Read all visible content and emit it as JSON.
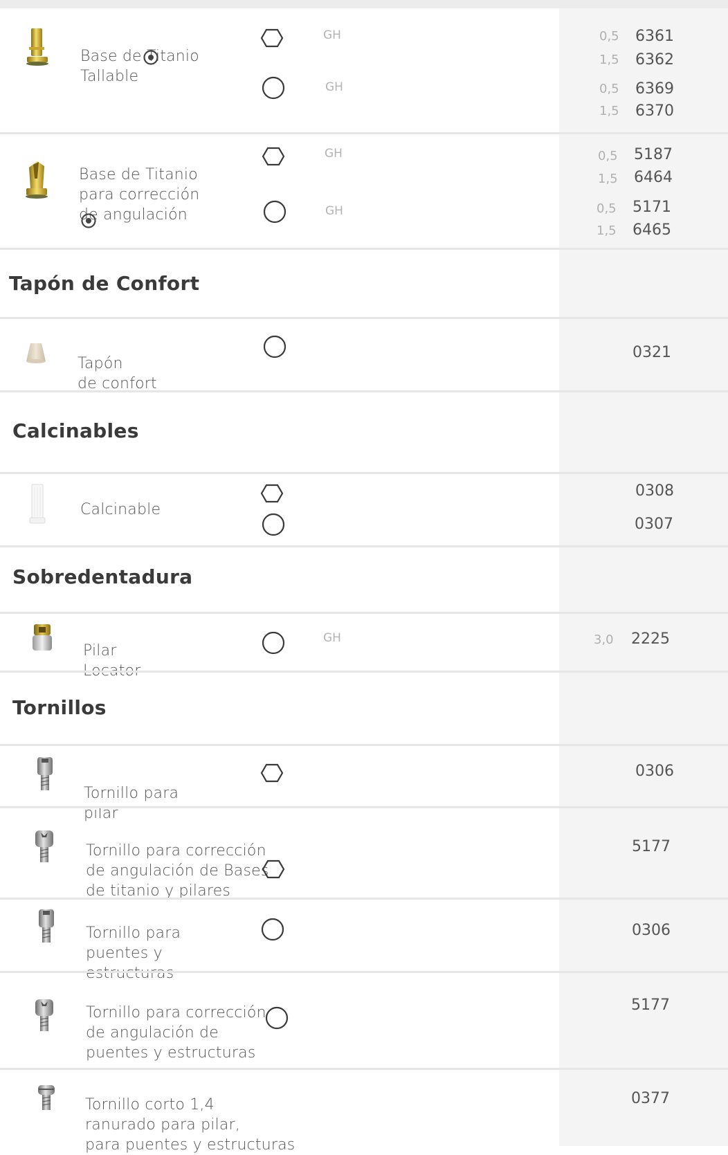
{
  "sections": {
    "tapon": "Tapón de Confort",
    "calcinables": "Calcinables",
    "sobredentadura": "Sobredentadura",
    "tornillos": "Tornillos"
  },
  "products": {
    "base_tallable": {
      "name": "Base de Titanio\nTallable",
      "gh1": "GH",
      "gh2": "GH",
      "rows": [
        {
          "height": "0,5",
          "code": "6361"
        },
        {
          "height": "1,5",
          "code": "6362"
        },
        {
          "height": "0,5",
          "code": "6369"
        },
        {
          "height": "1,5",
          "code": "6370"
        }
      ]
    },
    "base_angulacion": {
      "name": "Base de Titanio\npara corrección\nde angulación",
      "gh1": "GH",
      "gh2": "GH",
      "rows": [
        {
          "height": "0,5",
          "code": "5187"
        },
        {
          "height": "1,5",
          "code": "6464"
        },
        {
          "height": "0,5",
          "code": "5171"
        },
        {
          "height": "1,5",
          "code": "6465"
        }
      ]
    },
    "tapon_confort": {
      "name": "Tapón\nde confort",
      "code": "0321"
    },
    "calcinable": {
      "name": "Calcinable",
      "code_hex": "0308",
      "code_round": "0307"
    },
    "pilar_locator": {
      "name": "Pilar\nLocator",
      "gh": "GH",
      "height": "3,0",
      "code": "2225"
    },
    "tornillo_pilar": {
      "name": "Tornillo para\npilar",
      "code": "0306"
    },
    "tornillo_correccion_bases": {
      "name": "Tornillo para corrección\nde angulación de Bases\nde titanio y pilares",
      "code": "5177"
    },
    "tornillo_puentes": {
      "name": "Tornillo para\npuentes y\nestructuras",
      "code": "0306"
    },
    "tornillo_correccion_puentes": {
      "name": "Tornillo para corrección\nde angulación de\npuentes y estructuras",
      "code": "5177"
    },
    "tornillo_corto": {
      "name": "Tornillo corto 1,4\nranurado para pilar,\npara puentes  y estructuras",
      "code": "0377"
    }
  },
  "icons": {
    "hexagon": "hexagon-connection-icon",
    "circle": "round-connection-icon",
    "target": "target-icon"
  },
  "colors": {
    "text": "#555555",
    "muted": "#b0b0b0",
    "right_column": "#f4f4f4",
    "divider": "#e6e6e6",
    "gold": "#d4b33a",
    "steel": "#8e8e8e"
  }
}
